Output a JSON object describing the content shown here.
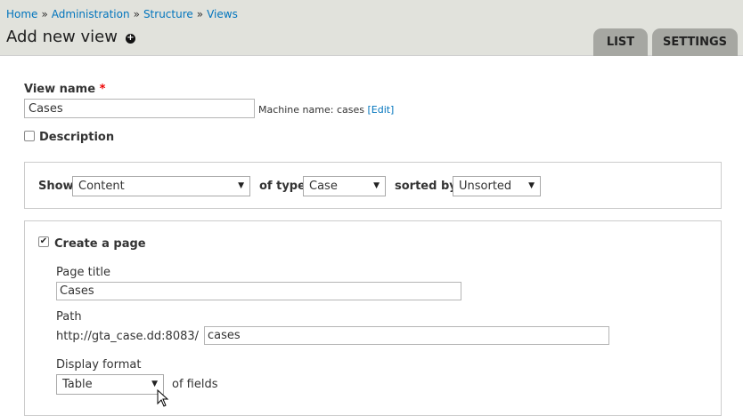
{
  "breadcrumb": {
    "items": [
      "Home",
      "Administration",
      "Structure",
      "Views"
    ],
    "separator": "»"
  },
  "page_title": "Add new view",
  "add_icon": "plus-circle-icon",
  "tabs": [
    {
      "label": "LIST"
    },
    {
      "label": "SETTINGS"
    }
  ],
  "view_name": {
    "label": "View name",
    "required_marker": "*",
    "value": "Cases",
    "machine_name_prefix": "Machine name: cases",
    "edit_link": "[Edit]"
  },
  "description": {
    "label": "Description",
    "checked": false
  },
  "show_panel": {
    "show_label": "Show",
    "show_value": "Content",
    "of_type_label": "of type",
    "type_value": "Case",
    "sorted_by_label": "sorted by",
    "sort_value": "Unsorted"
  },
  "page_panel": {
    "create_page_label": "Create a page",
    "create_page_checked": true,
    "page_title_label": "Page title",
    "page_title_value": "Cases",
    "path_label": "Path",
    "path_prefix": "http://gta_case.dd:8083/",
    "path_value": "cases",
    "display_format_label": "Display format",
    "display_format_value": "Table",
    "of_fields": "of fields"
  },
  "colors": {
    "link": "#0074bd",
    "header_bg": "#e1e2dc",
    "tab_bg": "#a6a7a2",
    "required": "#ee0000"
  }
}
